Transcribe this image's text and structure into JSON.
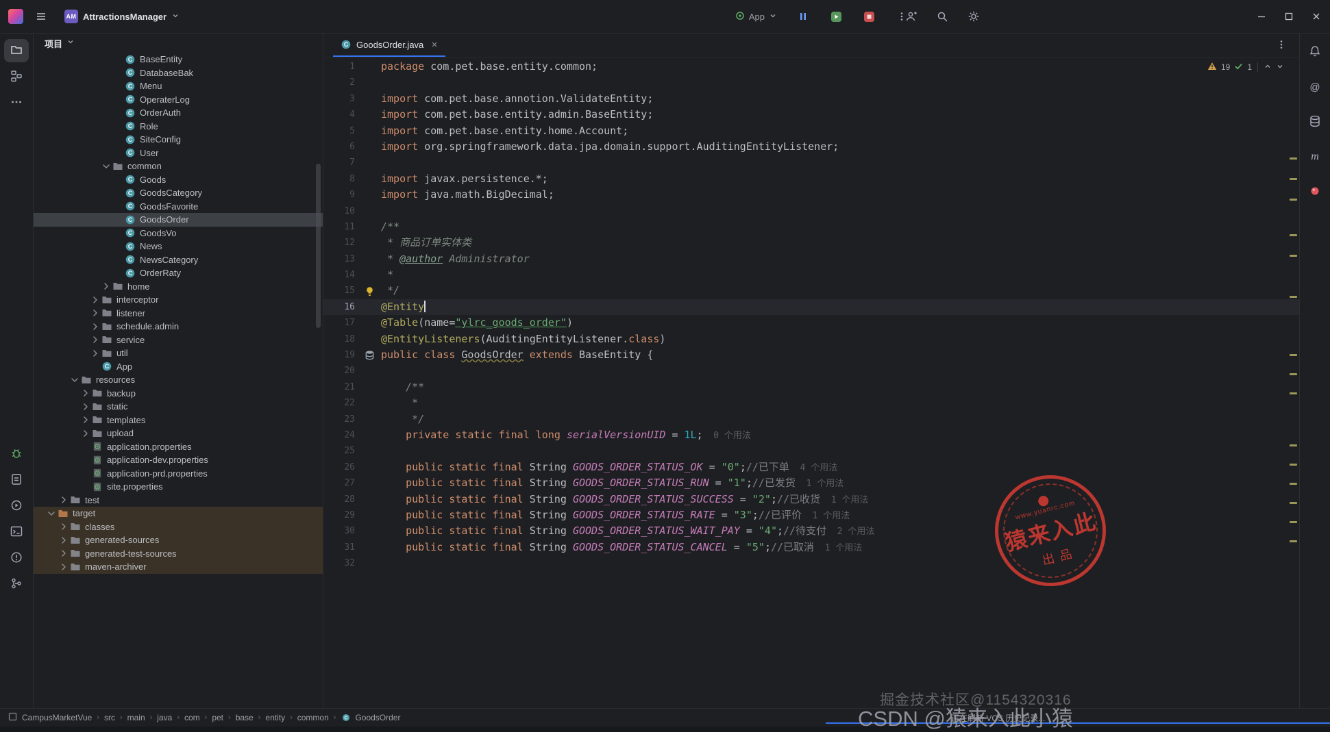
{
  "colors": {
    "accent": "#3574f0",
    "warning_stripe": "#b3ae60",
    "selected_row": "#3d4146",
    "excluded_row": "#3a3226",
    "stamp_red": "#d23b33",
    "run_green": "#57965c",
    "stop_red": "#c94f4f"
  },
  "icons": {
    "hamburger": "three-bars",
    "search": "magnifier",
    "settings": "gear",
    "minimize": "bar",
    "maximize": "square",
    "close": "x",
    "notifications": "bell",
    "warning": "yellow-triangle",
    "passed": "green-check",
    "class": "circle-C",
    "folder": "folder",
    "properties": "file-gear",
    "lightbulb": "intention-bulb",
    "jpa-entity": "database"
  },
  "title_bar": {
    "project": {
      "avatar": "AM",
      "name": "AttractionsManager"
    },
    "run_widget": {
      "config": "App"
    }
  },
  "left_toolbar": {
    "top": [
      "project",
      "structure",
      "more"
    ],
    "bottom": [
      "debug",
      "todo",
      "services",
      "terminal",
      "problems",
      "version-control"
    ]
  },
  "right_toolbar": {
    "items": [
      "notifications",
      "mentions",
      "database",
      "maven",
      "plugin"
    ]
  },
  "project_panel": {
    "title": "项目",
    "items": [
      {
        "label": "BaseEntity",
        "icon": "class",
        "indent": 116
      },
      {
        "label": "DatabaseBak",
        "icon": "class",
        "indent": 116
      },
      {
        "label": "Menu",
        "icon": "class",
        "indent": 116
      },
      {
        "label": "OperaterLog",
        "icon": "class",
        "indent": 116
      },
      {
        "label": "OrderAuth",
        "icon": "class",
        "indent": 116
      },
      {
        "label": "Role",
        "icon": "class",
        "indent": 116
      },
      {
        "label": "SiteConfig",
        "icon": "class",
        "indent": 116
      },
      {
        "label": "User",
        "icon": "class",
        "indent": 116
      },
      {
        "label": "common",
        "icon": "folder",
        "chevron": "down",
        "indent": 98
      },
      {
        "label": "Goods",
        "icon": "class",
        "indent": 116
      },
      {
        "label": "GoodsCategory",
        "icon": "class",
        "indent": 116
      },
      {
        "label": "GoodsFavorite",
        "icon": "class",
        "indent": 116
      },
      {
        "label": "GoodsOrder",
        "icon": "class",
        "indent": 116,
        "selected": true
      },
      {
        "label": "GoodsVo",
        "icon": "class",
        "indent": 116
      },
      {
        "label": "News",
        "icon": "class",
        "indent": 116
      },
      {
        "label": "NewsCategory",
        "icon": "class",
        "indent": 116
      },
      {
        "label": "OrderRaty",
        "icon": "class",
        "indent": 116
      },
      {
        "label": "home",
        "icon": "folder",
        "chevron": "right",
        "indent": 98
      },
      {
        "label": "interceptor",
        "icon": "folder",
        "chevron": "right",
        "indent": 82
      },
      {
        "label": "listener",
        "icon": "folder",
        "chevron": "right",
        "indent": 82
      },
      {
        "label": "schedule.admin",
        "icon": "folder",
        "chevron": "right",
        "indent": 82
      },
      {
        "label": "service",
        "icon": "folder",
        "chevron": "right",
        "indent": 82
      },
      {
        "label": "util",
        "icon": "folder",
        "chevron": "right",
        "indent": 82
      },
      {
        "label": "App",
        "icon": "class",
        "indent": 82
      },
      {
        "label": "resources",
        "icon": "folder",
        "chevron": "down",
        "indent": 52
      },
      {
        "label": "backup",
        "icon": "folder",
        "chevron": "right",
        "indent": 68
      },
      {
        "label": "static",
        "icon": "folder",
        "chevron": "right",
        "indent": 68
      },
      {
        "label": "templates",
        "icon": "folder",
        "chevron": "right",
        "indent": 68
      },
      {
        "label": "upload",
        "icon": "folder",
        "chevron": "right",
        "indent": 68
      },
      {
        "label": "application.properties",
        "icon": "properties",
        "indent": 68
      },
      {
        "label": "application-dev.properties",
        "icon": "properties",
        "indent": 68
      },
      {
        "label": "application-prd.properties",
        "icon": "properties",
        "indent": 68
      },
      {
        "label": "site.properties",
        "icon": "properties",
        "indent": 68
      },
      {
        "label": "test",
        "icon": "folder",
        "chevron": "right",
        "indent": 36
      },
      {
        "label": "target",
        "icon": "folder-excluded",
        "chevron": "down",
        "indent": 18,
        "excluded": true
      },
      {
        "label": "classes",
        "icon": "folder",
        "chevron": "right",
        "indent": 36,
        "excluded": true
      },
      {
        "label": "generated-sources",
        "icon": "folder",
        "chevron": "right",
        "indent": 36,
        "excluded": true
      },
      {
        "label": "generated-test-sources",
        "icon": "folder",
        "chevron": "right",
        "indent": 36,
        "excluded": true
      },
      {
        "label": "maven-archiver",
        "icon": "folder",
        "chevron": "right",
        "indent": 36,
        "excluded": true
      }
    ]
  },
  "editor": {
    "tab": {
      "title": "GoodsOrder.java"
    },
    "inspections": {
      "warnings": "19",
      "passed": "1"
    },
    "current_line": 16,
    "gutter_icons": {
      "15": "lightbulb",
      "19": "jpa-entity"
    },
    "stripe_marks": [
      146,
      176,
      206,
      258,
      288,
      348,
      433,
      461,
      489,
      565,
      593,
      621,
      649,
      677,
      705
    ],
    "lines": [
      {
        "n": 1,
        "segs": [
          [
            "package ",
            "kw"
          ],
          [
            "com.pet.base.entity.common;",
            "pl"
          ]
        ]
      },
      {
        "n": 2,
        "segs": []
      },
      {
        "n": 3,
        "segs": [
          [
            "import ",
            "kw"
          ],
          [
            "com.pet.base.annotion.ValidateEntity;",
            "pl"
          ]
        ]
      },
      {
        "n": 4,
        "segs": [
          [
            "import ",
            "kw"
          ],
          [
            "com.pet.base.entity.admin.BaseEntity;",
            "pl"
          ]
        ]
      },
      {
        "n": 5,
        "segs": [
          [
            "import ",
            "kw"
          ],
          [
            "com.pet.base.entity.home.Account;",
            "pl"
          ]
        ]
      },
      {
        "n": 6,
        "segs": [
          [
            "import ",
            "kw"
          ],
          [
            "org.springframework.data.jpa.domain.support.AuditingEntityListener;",
            "pl"
          ]
        ]
      },
      {
        "n": 7,
        "segs": []
      },
      {
        "n": 8,
        "segs": [
          [
            "import ",
            "kw"
          ],
          [
            "javax.persistence.*;",
            "pl"
          ]
        ]
      },
      {
        "n": 9,
        "segs": [
          [
            "import ",
            "kw"
          ],
          [
            "java.math.BigDecimal;",
            "pl"
          ]
        ]
      },
      {
        "n": 10,
        "segs": []
      },
      {
        "n": 11,
        "segs": [
          [
            "/**",
            "doc"
          ]
        ]
      },
      {
        "n": 12,
        "segs": [
          [
            " * 商品订单实体类",
            "doc"
          ]
        ]
      },
      {
        "n": 13,
        "segs": [
          [
            " * ",
            "doc"
          ],
          [
            "@author",
            "doctag"
          ],
          [
            " Administrator",
            "doc"
          ]
        ]
      },
      {
        "n": 14,
        "segs": [
          [
            " *",
            "doc"
          ]
        ]
      },
      {
        "n": 15,
        "segs": [
          [
            " */",
            "doc"
          ]
        ]
      },
      {
        "n": 16,
        "cursor": true,
        "segs": [
          [
            "@Entity",
            "ann"
          ]
        ]
      },
      {
        "n": 17,
        "segs": [
          [
            "@Table",
            "ann"
          ],
          [
            "(name=",
            "pl"
          ],
          [
            "\"ylrc_goods_order\"",
            "strU"
          ],
          [
            ")",
            "pl"
          ]
        ]
      },
      {
        "n": 18,
        "segs": [
          [
            "@EntityListeners",
            "ann"
          ],
          [
            "(AuditingEntityListener.",
            "pl"
          ],
          [
            "class",
            "kw"
          ],
          [
            ")",
            "pl"
          ]
        ]
      },
      {
        "n": 19,
        "segs": [
          [
            "public class ",
            "kw"
          ],
          [
            "GoodsOrder",
            "clsU"
          ],
          [
            " extends ",
            "kw"
          ],
          [
            "BaseEntity {",
            "pl"
          ]
        ]
      },
      {
        "n": 20,
        "segs": []
      },
      {
        "n": 21,
        "segs": [
          [
            "    /**",
            "doc"
          ]
        ]
      },
      {
        "n": 22,
        "segs": [
          [
            "     *",
            "doc"
          ]
        ]
      },
      {
        "n": 23,
        "segs": [
          [
            "     */",
            "doc"
          ]
        ]
      },
      {
        "n": 24,
        "segs": [
          [
            "    ",
            "pl"
          ],
          [
            "private static final long ",
            "kw"
          ],
          [
            "serialVersionUID",
            "const"
          ],
          [
            " = ",
            "pl"
          ],
          [
            "1L",
            "num"
          ],
          [
            ";",
            "pl"
          ],
          [
            "  0 个用法",
            "hint"
          ]
        ]
      },
      {
        "n": 25,
        "segs": []
      },
      {
        "n": 26,
        "segs": [
          [
            "    ",
            "pl"
          ],
          [
            "public static final ",
            "kw"
          ],
          [
            "String ",
            "pl"
          ],
          [
            "GOODS_ORDER_STATUS_OK",
            "const"
          ],
          [
            " = ",
            "pl"
          ],
          [
            "\"0\"",
            "str"
          ],
          [
            ";",
            "pl"
          ],
          [
            "//已下单",
            "cmt"
          ],
          [
            "  4 个用法",
            "hint"
          ]
        ]
      },
      {
        "n": 27,
        "segs": [
          [
            "    ",
            "pl"
          ],
          [
            "public static final ",
            "kw"
          ],
          [
            "String ",
            "pl"
          ],
          [
            "GOODS_ORDER_STATUS_RUN",
            "const"
          ],
          [
            " = ",
            "pl"
          ],
          [
            "\"1\"",
            "str"
          ],
          [
            ";",
            "pl"
          ],
          [
            "//已发货",
            "cmt"
          ],
          [
            "  1 个用法",
            "hint"
          ]
        ]
      },
      {
        "n": 28,
        "segs": [
          [
            "    ",
            "pl"
          ],
          [
            "public static final ",
            "kw"
          ],
          [
            "String ",
            "pl"
          ],
          [
            "GOODS_ORDER_STATUS_SUCCESS",
            "const"
          ],
          [
            " = ",
            "pl"
          ],
          [
            "\"2\"",
            "str"
          ],
          [
            ";",
            "pl"
          ],
          [
            "//已收货",
            "cmt"
          ],
          [
            "  1 个用法",
            "hint"
          ]
        ]
      },
      {
        "n": 29,
        "segs": [
          [
            "    ",
            "pl"
          ],
          [
            "public static final ",
            "kw"
          ],
          [
            "String ",
            "pl"
          ],
          [
            "GOODS_ORDER_STATUS_RATE",
            "const"
          ],
          [
            " = ",
            "pl"
          ],
          [
            "\"3\"",
            "str"
          ],
          [
            ";",
            "pl"
          ],
          [
            "//已评价",
            "cmt"
          ],
          [
            "  1 个用法",
            "hint"
          ]
        ]
      },
      {
        "n": 30,
        "segs": [
          [
            "    ",
            "pl"
          ],
          [
            "public static final ",
            "kw"
          ],
          [
            "String ",
            "pl"
          ],
          [
            "GOODS_ORDER_STATUS_WAIT_PAY",
            "const"
          ],
          [
            " = ",
            "pl"
          ],
          [
            "\"4\"",
            "str"
          ],
          [
            ";",
            "pl"
          ],
          [
            "//待支付",
            "cmt"
          ],
          [
            "  2 个用法",
            "hint"
          ]
        ]
      },
      {
        "n": 31,
        "segs": [
          [
            "    ",
            "pl"
          ],
          [
            "public static final ",
            "kw"
          ],
          [
            "String ",
            "pl"
          ],
          [
            "GOODS_ORDER_STATUS_CANCEL",
            "const"
          ],
          [
            " = ",
            "pl"
          ],
          [
            "\"5\"",
            "str"
          ],
          [
            ";",
            "pl"
          ],
          [
            "//已取消",
            "cmt"
          ],
          [
            "  1 个用法",
            "hint"
          ]
        ]
      },
      {
        "n": 32,
        "segs": []
      }
    ]
  },
  "status_bar": {
    "module": "CampusMarketVue",
    "path": [
      "src",
      "main",
      "java",
      "com",
      "pet",
      "base",
      "entity",
      "common"
    ],
    "file": "GoodsOrder",
    "vcs_message": "正在刷新 VCS 历史记录..."
  },
  "watermarks": {
    "juejin": "掘金技术社区@1154320316",
    "csdn": "CSDN @猿来入此小猿",
    "stamp": {
      "top": "www.yuanrc.com",
      "main": "猿来入此",
      "sub": "出品"
    }
  }
}
